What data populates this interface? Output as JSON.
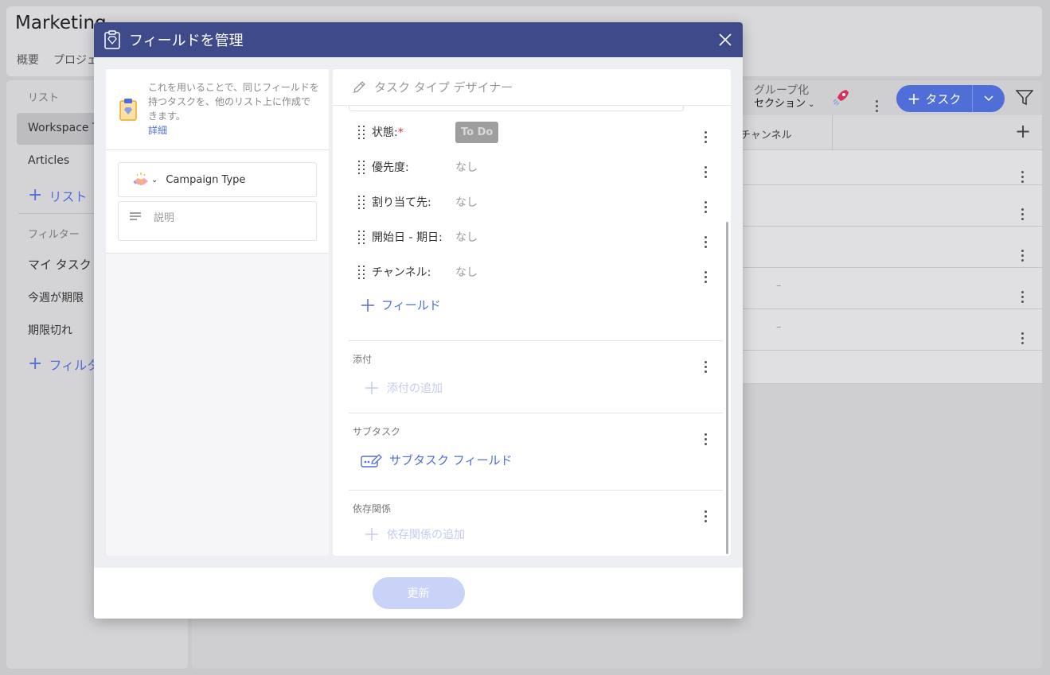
{
  "background": {
    "title": "Marketing",
    "tabs": [
      "概要",
      "プロジェ"
    ],
    "sidebar": {
      "lists_header": "リスト",
      "lists": [
        "Workspace Ta",
        "Articles"
      ],
      "add_list": "リスト",
      "filters_header": "フィルター",
      "filters": [
        "マイ タスク",
        "今週が期限",
        "期限切れ"
      ],
      "add_filter": "フィルタ"
    },
    "toolbar": {
      "group_line1": "グループ化",
      "group_line2": "セクション",
      "task_button": "タスク"
    },
    "grid": {
      "column_header": "チャンネル",
      "dash": "–"
    }
  },
  "modal": {
    "title": "フィールドを管理",
    "info_text": "これを用いることで、同じフィールドを持つタスクを、他のリスト上に作成できます。",
    "info_link": "詳細",
    "type_name": "Campaign Type",
    "description_placeholder": "説明",
    "designer_title": "タスク タイプ デザイナー",
    "fields": [
      {
        "label": "状態:",
        "required": "*",
        "value": "To Do"
      },
      {
        "label": "優先度:",
        "value": "なし"
      },
      {
        "label": "割り当て先:",
        "value": "なし"
      },
      {
        "label": "開始日 - 期日:",
        "value": "なし"
      },
      {
        "label": "チャンネル:",
        "value": "なし"
      }
    ],
    "add_field": "フィールド",
    "sections": {
      "attachments": {
        "title": "添付",
        "action": "添付の追加"
      },
      "subtasks": {
        "title": "サブタスク",
        "action": "サブタスク フィールド"
      },
      "dependencies": {
        "title": "依存関係",
        "action": "依存関係の追加"
      }
    },
    "update_button": "更新"
  }
}
